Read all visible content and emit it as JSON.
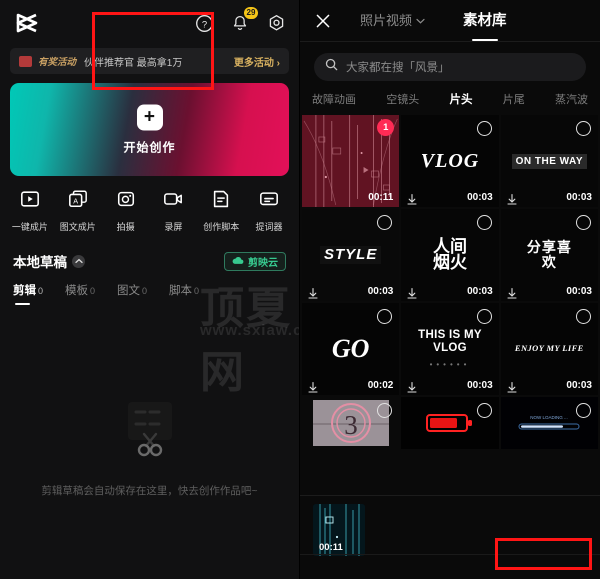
{
  "left": {
    "logo_icon": "capcut-logo",
    "top_icons": [
      {
        "name": "help-icon",
        "glyph": "?"
      },
      {
        "name": "bell-icon",
        "badge": "29"
      },
      {
        "name": "settings-icon"
      }
    ],
    "banner": {
      "tag": "有奖活动",
      "text": "伙伴推荐官 最高拿1万",
      "more": "更多活动 ›"
    },
    "create": {
      "plus": "+",
      "label": "开始创作"
    },
    "tools": [
      {
        "icon": "auto-cut-icon",
        "label": "一键成片"
      },
      {
        "icon": "text-to-video-icon",
        "label": "图文成片"
      },
      {
        "icon": "camera-icon",
        "label": "拍摄"
      },
      {
        "icon": "screen-record-icon",
        "label": "录屏"
      },
      {
        "icon": "script-icon",
        "label": "创作脚本"
      },
      {
        "icon": "teleprompter-icon",
        "label": "提词器"
      }
    ],
    "drafts": {
      "title": "本地草稿",
      "cloud_button": "剪映云",
      "tabs": [
        {
          "name": "剪辑",
          "count": "0",
          "active": true
        },
        {
          "name": "模板",
          "count": "0",
          "active": false
        },
        {
          "name": "图文",
          "count": "0",
          "active": false
        },
        {
          "name": "脚本",
          "count": "0",
          "active": false
        }
      ],
      "empty_text": "剪辑草稿会自动保存在这里，快去创作作品吧~"
    },
    "watermark": {
      "line1": "顶夏网",
      "line2": "www.sxiaw.com"
    }
  },
  "right": {
    "header": {
      "close_icon": "close-icon",
      "dropdown_label": "照片视频",
      "dropdown_icon": "chevron-down-icon",
      "active_tab": "素材库"
    },
    "search": {
      "icon": "search-icon",
      "placeholder": "大家都在搜「风景」"
    },
    "categories": [
      {
        "label": "故障动画",
        "active": false
      },
      {
        "label": "空镜头",
        "active": false
      },
      {
        "label": "片头",
        "active": true
      },
      {
        "label": "片尾",
        "active": false
      },
      {
        "label": "蒸汽波",
        "active": false
      }
    ],
    "items": [
      {
        "style": "glitch-red",
        "text": "",
        "duration": "00:11",
        "selected": true,
        "select_number": "1",
        "downloadable": false
      },
      {
        "style": "plain",
        "text": "VLOG",
        "duration": "00:03",
        "selected": false,
        "downloadable": true
      },
      {
        "style": "plain",
        "text": "ON THE WAY",
        "duration": "00:03",
        "selected": false,
        "downloadable": true
      },
      {
        "style": "plain",
        "text": "STYLE",
        "duration": "00:03",
        "selected": false,
        "downloadable": true
      },
      {
        "style": "plain",
        "text": "人间烟火",
        "duration": "00:03",
        "selected": false,
        "downloadable": true
      },
      {
        "style": "plain",
        "text": "分享喜欢",
        "duration": "00:03",
        "selected": false,
        "downloadable": true
      },
      {
        "style": "plain",
        "text": "GO",
        "duration": "00:02",
        "selected": false,
        "downloadable": true
      },
      {
        "style": "plain",
        "text": "THIS IS MY VLOG",
        "duration": "00:03",
        "selected": false,
        "downloadable": true
      },
      {
        "style": "plain",
        "text": "ENJOY MY LIFE",
        "duration": "00:03",
        "selected": false,
        "downloadable": true
      },
      {
        "style": "countdown",
        "text": "3",
        "duration": "",
        "selected": false,
        "downloadable": false
      },
      {
        "style": "battery",
        "text": "",
        "duration": "",
        "selected": false,
        "downloadable": false
      },
      {
        "style": "loading-bar",
        "text": "",
        "duration": "",
        "selected": false,
        "downloadable": false
      }
    ],
    "tray": {
      "clip_duration": "00:11",
      "remove_icon": "close-icon"
    }
  },
  "colors": {
    "highlight": "#ff1515",
    "accent_pink": "#ff2b55",
    "accent_green": "#37c98f",
    "badge_yellow": "#f5c518"
  }
}
